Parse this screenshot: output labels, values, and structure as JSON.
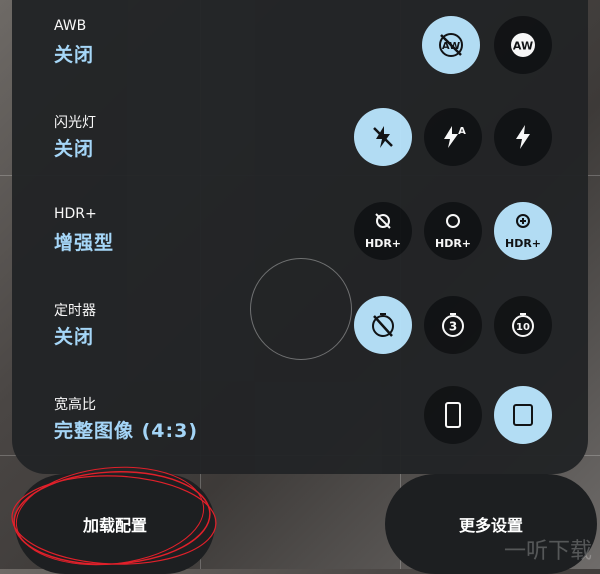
{
  "rows": [
    {
      "label": "AWB",
      "value": "关闭",
      "options": [
        {
          "icon": "awb-off-icon",
          "active": true
        },
        {
          "icon": "awb-auto-icon",
          "active": false,
          "text": "AW"
        }
      ]
    },
    {
      "label": "闪光灯",
      "value": "关闭",
      "options": [
        {
          "icon": "flash-off-icon",
          "active": true
        },
        {
          "icon": "flash-auto-icon",
          "active": false
        },
        {
          "icon": "flash-on-icon",
          "active": false
        }
      ]
    },
    {
      "label": "HDR+",
      "value": "增强型",
      "options": [
        {
          "icon": "hdr-off-icon",
          "active": false,
          "text": "HDR+"
        },
        {
          "icon": "hdr-on-icon",
          "active": false,
          "text": "HDR+"
        },
        {
          "icon": "hdr-enhanced-icon",
          "active": true,
          "text": "HDR+"
        }
      ]
    },
    {
      "label": "定时器",
      "value": "关闭",
      "options": [
        {
          "icon": "timer-off-icon",
          "active": true
        },
        {
          "icon": "timer-3s-icon",
          "active": false,
          "text": "3"
        },
        {
          "icon": "timer-10s-icon",
          "active": false,
          "text": "10"
        }
      ]
    },
    {
      "label": "宽高比",
      "value": "完整图像 (4:3)",
      "options": [
        {
          "icon": "aspect-full-icon",
          "active": false
        },
        {
          "icon": "aspect-4-3-icon",
          "active": true
        }
      ]
    }
  ],
  "buttons": {
    "load_config": "加载配置",
    "more_settings": "更多设置"
  },
  "watermark": "一听下载",
  "colors": {
    "accent": "#b7e3fb",
    "value_text": "#a9dcff",
    "panel": "#222426",
    "annotation": "#e0202a"
  }
}
